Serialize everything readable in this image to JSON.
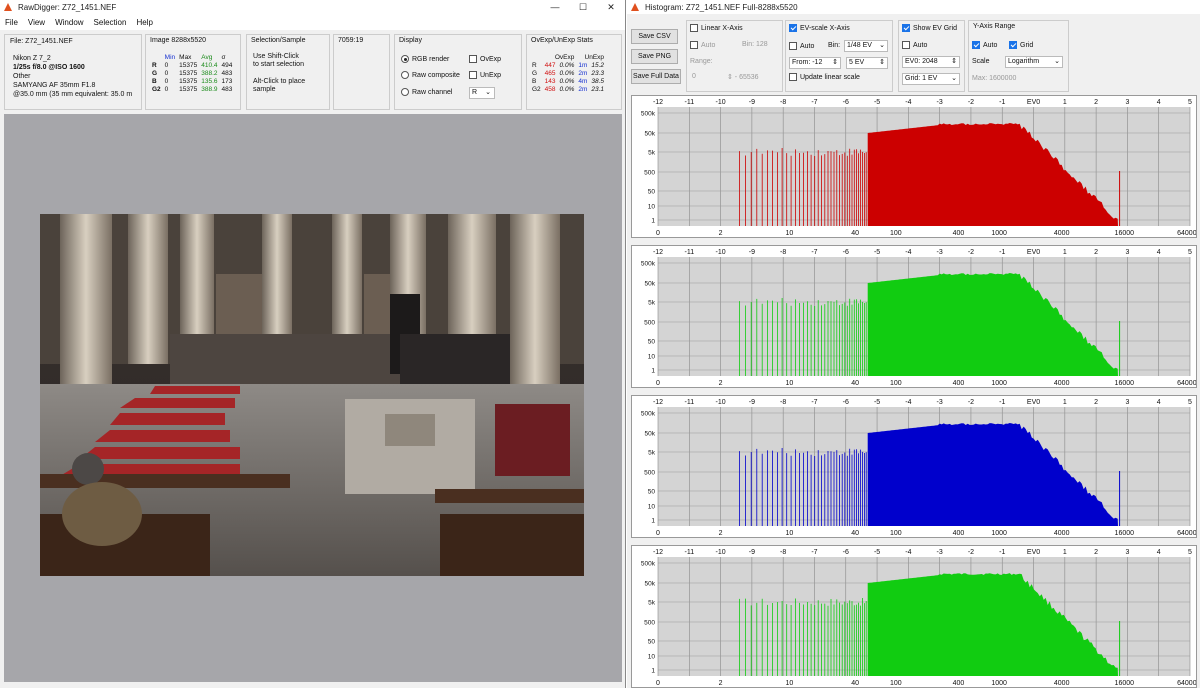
{
  "main": {
    "title": "RawDigger: Z72_1451.NEF",
    "menu": [
      "File",
      "View",
      "Window",
      "Selection",
      "Help"
    ],
    "file_label": "File: Z72_1451.NEF",
    "camera": "Nikon Z 7_2",
    "exposure": "1/25s f/8.0 @ISO 1600",
    "mode": "Other",
    "lens": "SAMYANG AF 35mm F1.8",
    "focal": "@35.0 mm (35 mm equivalent: 35.0 m",
    "image_title": "Image 8288x5520",
    "stats_headers": [
      "",
      "Min",
      "Max",
      "Avg",
      "σ"
    ],
    "stats": [
      {
        "ch": "R",
        "min": "0",
        "max": "15375",
        "avg": "410.4",
        "sd": "494"
      },
      {
        "ch": "G",
        "min": "0",
        "max": "15375",
        "avg": "388.2",
        "sd": "483"
      },
      {
        "ch": "B",
        "min": "0",
        "max": "15375",
        "avg": "135.6",
        "sd": "173"
      },
      {
        "ch": "G2",
        "min": "0",
        "max": "15375",
        "avg": "388.9",
        "sd": "483"
      }
    ],
    "sel_title": "Selection/Sample",
    "sel_line1": "Use Shift-Click",
    "sel_line2": "to start selection",
    "sel_line3": "Alt-Click to place",
    "sel_line4": "sample",
    "coords": "7059:19",
    "display_title": "Display",
    "rgb_render": "RGB render",
    "raw_composite": "Raw composite",
    "raw_channel": "Raw channel",
    "channel_value": "R",
    "ovexp": "OvExp",
    "unexp": "UnExp",
    "ovstats_title": "OvExp/UnExp Stats",
    "ov_headers": [
      "",
      "OvExp",
      "",
      "UnExp",
      ""
    ],
    "ov_rows": [
      {
        "ch": "R",
        "n": "447",
        "pct": "0.0%",
        "u": "1m",
        "up": "15.2"
      },
      {
        "ch": "G",
        "n": "465",
        "pct": "0.0%",
        "u": "2m",
        "up": "23.3"
      },
      {
        "ch": "B",
        "n": "143",
        "pct": "0.0%",
        "u": "4m",
        "up": "38.5"
      },
      {
        "ch": "G2",
        "n": "458",
        "pct": "0.0%",
        "u": "2m",
        "up": "23.1"
      }
    ]
  },
  "histwin": {
    "title": "Histogram: Z72_1451.NEF Full-8288x5520",
    "save_csv": "Save CSV",
    "save_png": "Save PNG",
    "save_full": "Save Full Data",
    "linear_x": "Linear X-Axis",
    "auto": "Auto",
    "bin_label": "Bin: 128",
    "range_label": "Range:",
    "range_from": "0",
    "range_to": "65536",
    "ev_scale": "EV-scale X-Axis",
    "bin2": "Bin:",
    "bin2_value": "1/48 EV",
    "from_label": "From: -12",
    "to_value": "5 EV",
    "update_linear": "Update linear scale",
    "show_grid": "Show EV Grid",
    "ev0": "EV0: 2048",
    "grid_value": "Grid: 1 EV",
    "yrange": "Y-Axis Range",
    "grid": "Grid",
    "scale_label": "Scale",
    "scale_value": "Logarithm",
    "max_label": "Max: 1600000",
    "ev_ticks": [
      "-12",
      "-11",
      "-10",
      "-9",
      "-8",
      "-7",
      "-6",
      "-5",
      "-4",
      "-3",
      "-2",
      "-1",
      "EV0",
      "1",
      "2",
      "3",
      "4",
      "5"
    ],
    "lin_ticks": [
      "0",
      "2",
      "10",
      "40",
      "100",
      "400",
      "1000",
      "4000",
      "16000",
      "64000"
    ],
    "y_ticks": [
      "500k",
      "50k",
      "5k",
      "500",
      "50",
      "10",
      "1"
    ],
    "colors": {
      "r": "#cc0000",
      "g": "#11cc11",
      "b": "#0000cc",
      "g2": "#11cc11"
    }
  }
}
